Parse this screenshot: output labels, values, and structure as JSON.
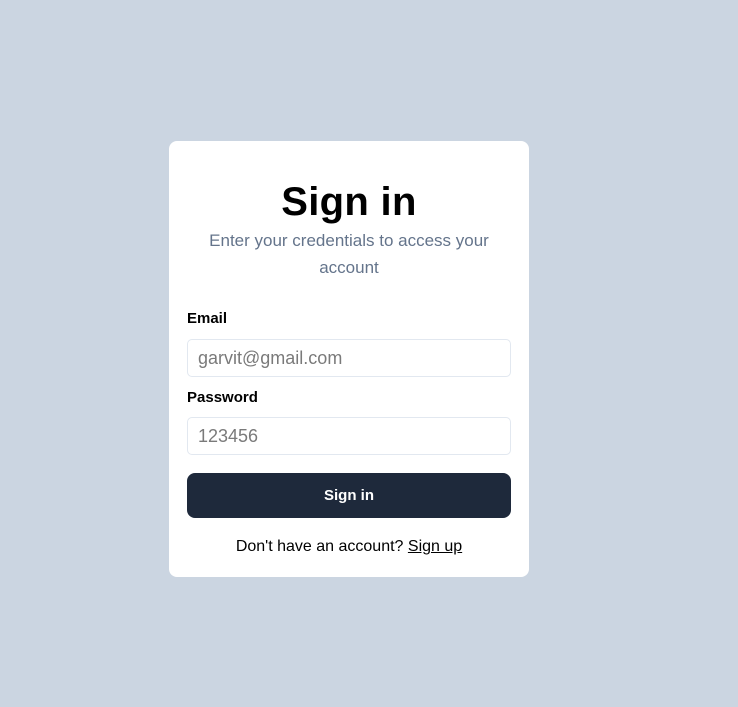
{
  "signin": {
    "title": "Sign in",
    "subtitle": "Enter your credentials to access your account",
    "email_label": "Email",
    "email_placeholder": "garvit@gmail.com",
    "password_label": "Password",
    "password_placeholder": "123456",
    "submit_label": "Sign in",
    "footer_text": "Don't have an account? ",
    "signup_link": "Sign up"
  },
  "colors": {
    "background": "#cbd5e1",
    "card": "#ffffff",
    "button": "#1e293b",
    "subtitle": "#64748b"
  }
}
